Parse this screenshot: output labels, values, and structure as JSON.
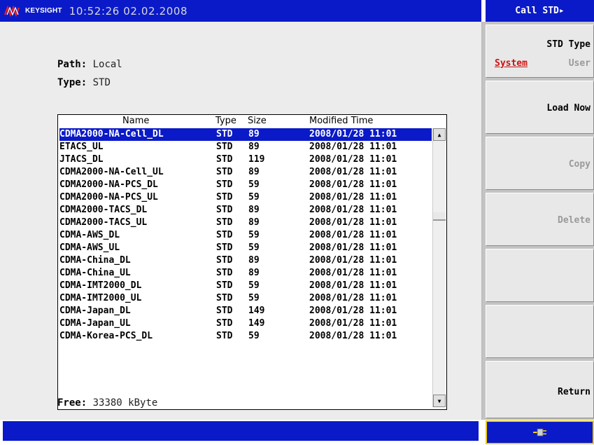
{
  "header": {
    "brand": "KEYSIGHT",
    "datetime": "10:52:26 02.02.2008",
    "menu_title": "Call STD▸"
  },
  "info": {
    "path_label": "Path:",
    "path_value": "Local",
    "type_label": "Type:",
    "type_value": "STD"
  },
  "file_list": {
    "columns": [
      "Name",
      "Type",
      "Size",
      "Modified Time"
    ],
    "selected_index": 0,
    "rows": [
      {
        "name": "CDMA2000-NA-Cell_DL",
        "type": "STD",
        "size": "89",
        "modified": "2008/01/28 11:01"
      },
      {
        "name": "ETACS_UL",
        "type": "STD",
        "size": "89",
        "modified": "2008/01/28 11:01"
      },
      {
        "name": "JTACS_DL",
        "type": "STD",
        "size": "119",
        "modified": "2008/01/28 11:01"
      },
      {
        "name": "CDMA2000-NA-Cell_UL",
        "type": "STD",
        "size": "89",
        "modified": "2008/01/28 11:01"
      },
      {
        "name": "CDMA2000-NA-PCS_DL",
        "type": "STD",
        "size": "59",
        "modified": "2008/01/28 11:01"
      },
      {
        "name": "CDMA2000-NA-PCS_UL",
        "type": "STD",
        "size": "59",
        "modified": "2008/01/28 11:01"
      },
      {
        "name": "CDMA2000-TACS_DL",
        "type": "STD",
        "size": "89",
        "modified": "2008/01/28 11:01"
      },
      {
        "name": "CDMA2000-TACS_UL",
        "type": "STD",
        "size": "89",
        "modified": "2008/01/28 11:01"
      },
      {
        "name": "CDMA-AWS_DL",
        "type": "STD",
        "size": "59",
        "modified": "2008/01/28 11:01"
      },
      {
        "name": "CDMA-AWS_UL",
        "type": "STD",
        "size": "59",
        "modified": "2008/01/28 11:01"
      },
      {
        "name": "CDMA-China_DL",
        "type": "STD",
        "size": "89",
        "modified": "2008/01/28 11:01"
      },
      {
        "name": "CDMA-China_UL",
        "type": "STD",
        "size": "89",
        "modified": "2008/01/28 11:01"
      },
      {
        "name": "CDMA-IMT2000_DL",
        "type": "STD",
        "size": "59",
        "modified": "2008/01/28 11:01"
      },
      {
        "name": "CDMA-IMT2000_UL",
        "type": "STD",
        "size": "59",
        "modified": "2008/01/28 11:01"
      },
      {
        "name": "CDMA-Japan_DL",
        "type": "STD",
        "size": "149",
        "modified": "2008/01/28 11:01"
      },
      {
        "name": "CDMA-Japan_UL",
        "type": "STD",
        "size": "149",
        "modified": "2008/01/28 11:01"
      },
      {
        "name": "CDMA-Korea-PCS_DL",
        "type": "STD",
        "size": "59",
        "modified": "2008/01/28 11:01"
      }
    ]
  },
  "footer": {
    "free_label": "Free:",
    "free_value": "33380 kByte"
  },
  "softkeys": {
    "std_type": {
      "title": "STD Type",
      "option_active": "System",
      "option_inactive": "User"
    },
    "load_now": "Load Now",
    "copy": "Copy",
    "delete": "Delete",
    "return": "Return"
  },
  "icons": {
    "logo": "keysight-wave-icon",
    "scroll_up": "arrow-up-icon",
    "scroll_down": "arrow-down-icon",
    "status": "plug-icon"
  },
  "colors": {
    "bar_blue": "#0a1ac8",
    "selection": "#0a1ac8",
    "active_option": "#cc1111",
    "status_border": "#f0d000"
  }
}
